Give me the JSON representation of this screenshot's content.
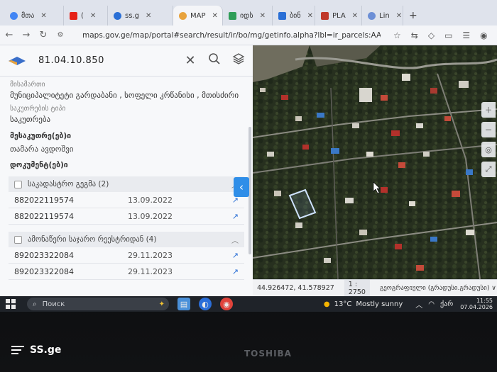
{
  "browser": {
    "tabs": [
      {
        "label": "მთა",
        "color": "#4285f4"
      },
      {
        "label": "(",
        "color": "#e62117"
      },
      {
        "label": "ss.g",
        "color": "#2a6fd6"
      },
      {
        "label": "MAP",
        "color": "#e8a33d"
      },
      {
        "label": "იდს",
        "color": "#2e9d57"
      },
      {
        "label": "ბინ",
        "color": "#2a6fd6"
      },
      {
        "label": "PLA",
        "color": "#c0392b"
      },
      {
        "label": "Lin",
        "color": "#6c8fd6"
      }
    ],
    "new_tab": "+",
    "url": "maps.gov.ge/map/portal#search/result/ir/bo/mg/getinfo.alpha?lbl=ir_parcels:AAArWyABpA..."
  },
  "panel": {
    "search_value": "81.04.10.850",
    "address_label": "მისამართი",
    "address_value": "მუნიციპალიტეტი გარდაბანი , სოფელი კრწანისი , მთისძირი",
    "ownership_label": "საკუთრების ტიპი",
    "ownership_value": "საკუთრება",
    "owners_title": "მესაკუთრე(ებ)ი",
    "owners_value": "თამარა ავდოშვი",
    "documents_title": "დოკუმენტ(ებ)ი",
    "groups": [
      {
        "title": "საკადასტრო გეგმა (2)",
        "rows": [
          {
            "number": "882022119574",
            "date": "13.09.2022"
          },
          {
            "number": "882022119574",
            "date": "13.09.2022"
          }
        ]
      },
      {
        "title": "ამონაწერი საჯარო რეესტრიდან (4)",
        "rows": [
          {
            "number": "892023322084",
            "date": "29.11.2023"
          },
          {
            "number": "892023322084",
            "date": "29.11.2023"
          }
        ]
      }
    ]
  },
  "map": {
    "coords": "44.926472, 41.578927",
    "scale": "1 : 2750",
    "projection": "გეოგრაფიული (გრადუსი.გრადუსი) ∨"
  },
  "taskbar": {
    "search_placeholder": "Поиск",
    "weather_temp": "13°C",
    "weather_text": "Mostly sunny",
    "lang": "ქარ",
    "time": "11:55",
    "date": "07.04.2026"
  },
  "bezel": {
    "brand": "TOSHIBA",
    "watermark": "SS.ge"
  }
}
